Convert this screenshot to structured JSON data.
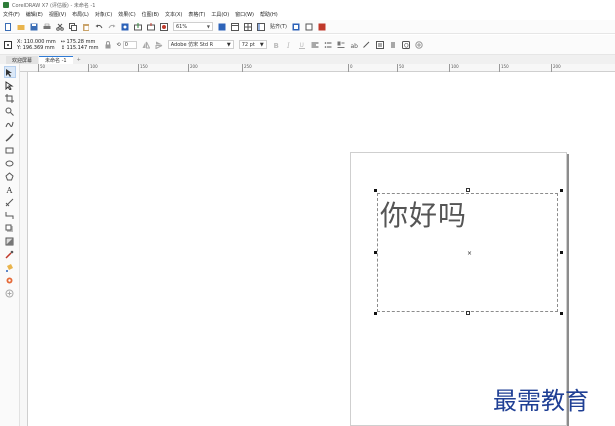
{
  "window": {
    "title": "CorelDRAW X7 (评估版) - 未命名 -1"
  },
  "menu": {
    "items": [
      "文件(F)",
      "编辑(E)",
      "视图(V)",
      "布局(L)",
      "对象(C)",
      "效果(C)",
      "位图(B)",
      "文本(X)",
      "表格(T)",
      "工具(O)",
      "窗口(W)",
      "帮助(H)"
    ]
  },
  "toolbar": {
    "zoom_value": "61%",
    "snap_label": "贴齐(T)"
  },
  "propbar": {
    "x_value": "X: 110.000 mm",
    "y_value": "Y: 196.369 mm",
    "w_value": "↔ 175.28 mm",
    "h_value": "↕ 115.147 mm",
    "rotation_value": "0",
    "font_name": "Adobe 仿宋 Std R",
    "font_size": "72 pt"
  },
  "tabs": {
    "items": [
      {
        "label": "欢迎屏幕"
      },
      {
        "label": "未命名 -1"
      }
    ],
    "add_label": "+"
  },
  "ruler": {
    "labels": [
      "50",
      "100",
      "150",
      "200",
      "250",
      "0",
      "50",
      "100",
      "150",
      "200"
    ]
  },
  "canvas": {
    "text_content": "你好吗",
    "center_mark": "×"
  },
  "watermark": {
    "text": "最需教育"
  }
}
